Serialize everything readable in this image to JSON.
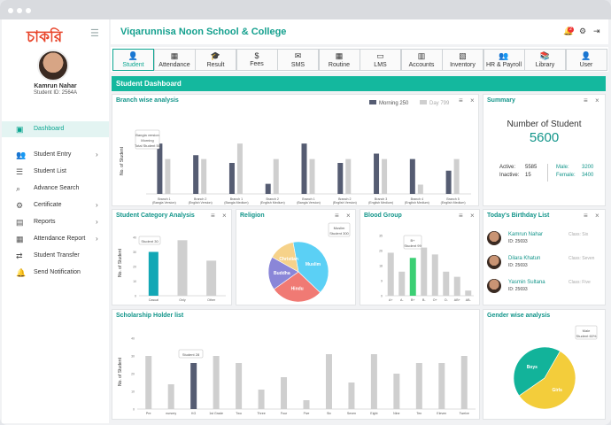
{
  "school_name": "Viqarunnisa Noon School & College",
  "logo_text": "চাকরি",
  "user": {
    "name": "Kamrun Nahar",
    "id": "Student ID: 2564A"
  },
  "notification_count": "2",
  "sidebar": [
    {
      "label": "Dashboard",
      "icon": "dashboard-icon",
      "chev": ""
    },
    {
      "label": "Student Entry",
      "icon": "student-entry-icon",
      "chev": "›"
    },
    {
      "label": "Student List",
      "icon": "list-icon",
      "chev": ""
    },
    {
      "label": "Advance Search",
      "icon": "search-icon",
      "chev": ""
    },
    {
      "label": "Certificate",
      "icon": "certificate-icon",
      "chev": "›"
    },
    {
      "label": "Reports",
      "icon": "reports-icon",
      "chev": "›"
    },
    {
      "label": "Attendance Report",
      "icon": "attendance-icon",
      "chev": "›"
    },
    {
      "label": "Student Transfer",
      "icon": "transfer-icon",
      "chev": ""
    },
    {
      "label": "Send Notification",
      "icon": "bell-icon",
      "chev": ""
    }
  ],
  "modules": [
    {
      "label": "Student",
      "icon": "student-icon"
    },
    {
      "label": "Attendance",
      "icon": "attendance-icon"
    },
    {
      "label": "Result",
      "icon": "result-icon"
    },
    {
      "label": "Fees",
      "icon": "fees-icon"
    },
    {
      "label": "SMS",
      "icon": "sms-icon"
    },
    {
      "label": "Routine",
      "icon": "routine-icon"
    },
    {
      "label": "LMS",
      "icon": "lms-icon"
    },
    {
      "label": "Accounts",
      "icon": "accounts-icon"
    },
    {
      "label": "Inventory",
      "icon": "inventory-icon"
    },
    {
      "label": "HR & Payroll",
      "icon": "hr-icon"
    },
    {
      "label": "Library",
      "icon": "library-icon"
    },
    {
      "label": "User",
      "icon": "user-icon"
    }
  ],
  "dashboard_title": "Student Dashboard",
  "panels": {
    "branch": "Branch wise analysis",
    "summary": "Summary",
    "category": "Student Category Analysis",
    "religion": "Religion",
    "blood": "Blood Group",
    "birthday": "Today's Birthday List",
    "scholarship": "Scholarship Holder list",
    "gender": "Gender wise analysis"
  },
  "summary": {
    "label": "Number of Student",
    "total": "5600",
    "active_label": "Active:",
    "active": "5585",
    "inactive_label": "Inactive:",
    "inactive": "15",
    "male_label": "Male:",
    "male": "3200",
    "female_label": "Female:",
    "female": "3400"
  },
  "birthdays": [
    {
      "name": "Kamrun Nahar",
      "id": "ID: 25693",
      "cls": "Class: Six"
    },
    {
      "name": "Dilara Khatun",
      "id": "ID: 25693",
      "cls": "Class: Seven"
    },
    {
      "name": "Yasmin Sultana",
      "id": "ID: 25693",
      "cls": "Class: Five"
    }
  ],
  "colors": {
    "accent": "#14b89e",
    "dark_bar": "#555c72",
    "light_bar": "#cfcfcf"
  },
  "chart_data": [
    {
      "type": "bar",
      "title": "Branch wise analysis",
      "ylabel": "No. of Student",
      "legend": [
        "Morning 250",
        "Day 799"
      ],
      "categories": [
        "Branch 1 (Bangla Version)",
        "Branch 2 (English Version)",
        "Branch 1 (Bangla Medium)",
        "Branch 2 (English Medium)",
        "Branch 1 (Bangla Version)",
        "Branch 2 (English Version)",
        "Branch 3 (English Medium)",
        "Branch 4 (English Medium)",
        "Branch 5 (English Medium)"
      ],
      "series": [
        {
          "name": "Morning 250",
          "values": [
            65,
            50,
            40,
            13,
            65,
            40,
            52,
            45,
            30
          ]
        },
        {
          "name": "Day 799",
          "values": [
            45,
            45,
            65,
            45,
            45,
            45,
            45,
            12,
            45
          ]
        }
      ],
      "tooltip": [
        "Bangla version",
        "Morning",
        "Total Student 50"
      ],
      "ylim": [
        0,
        80
      ]
    },
    {
      "type": "bar",
      "title": "Student Category Analysis",
      "ylabel": "No. of Student",
      "categories": [
        "Casual",
        "Only",
        "Other"
      ],
      "values": [
        30,
        38,
        24
      ],
      "highlight": 0,
      "tooltip": "Student 30",
      "ylim": [
        0,
        40
      ]
    },
    {
      "type": "pie",
      "title": "Religion",
      "labels": [
        "Muslim",
        "Hindu",
        "Buddha",
        "Christian"
      ],
      "values": [
        40,
        28,
        18,
        14
      ],
      "colors": [
        "#5bd0f5",
        "#f07a74",
        "#8a86d8",
        "#f6d28a"
      ],
      "tooltip": [
        "Muslim",
        "Student 300"
      ]
    },
    {
      "type": "bar",
      "title": "Blood Group",
      "ylabel": "",
      "categories": [
        "A+",
        "A-",
        "B+",
        "B-",
        "O+",
        "O-",
        "AB+",
        "AB-"
      ],
      "values": [
        25,
        14,
        22,
        28,
        24,
        14,
        11,
        3
      ],
      "highlight": 2,
      "tooltip": [
        "B+",
        "Student 99"
      ],
      "ylim": [
        0,
        35
      ]
    },
    {
      "type": "bar",
      "title": "Scholarship Holder list",
      "ylabel": "No. of Student",
      "categories": [
        "Pre",
        "nursery",
        "KG",
        "1st Grade",
        "Two",
        "Three",
        "Four",
        "Five",
        "Six",
        "Seven",
        "Eight",
        "Nine",
        "Ten",
        "Eleven",
        "Twelve"
      ],
      "values": [
        30,
        14,
        26,
        30,
        26,
        11,
        18,
        5,
        31,
        15,
        31,
        20,
        26,
        26,
        30
      ],
      "highlight": 2,
      "tooltip": "Student 28",
      "ylim": [
        0,
        40
      ]
    },
    {
      "type": "pie",
      "title": "Gender wise analysis",
      "labels": [
        "Boys",
        "Girls"
      ],
      "values": [
        43,
        57
      ],
      "colors": [
        "#12b39a",
        "#f3cd3b"
      ],
      "tooltip": [
        "Male",
        "Student 60%"
      ]
    }
  ]
}
